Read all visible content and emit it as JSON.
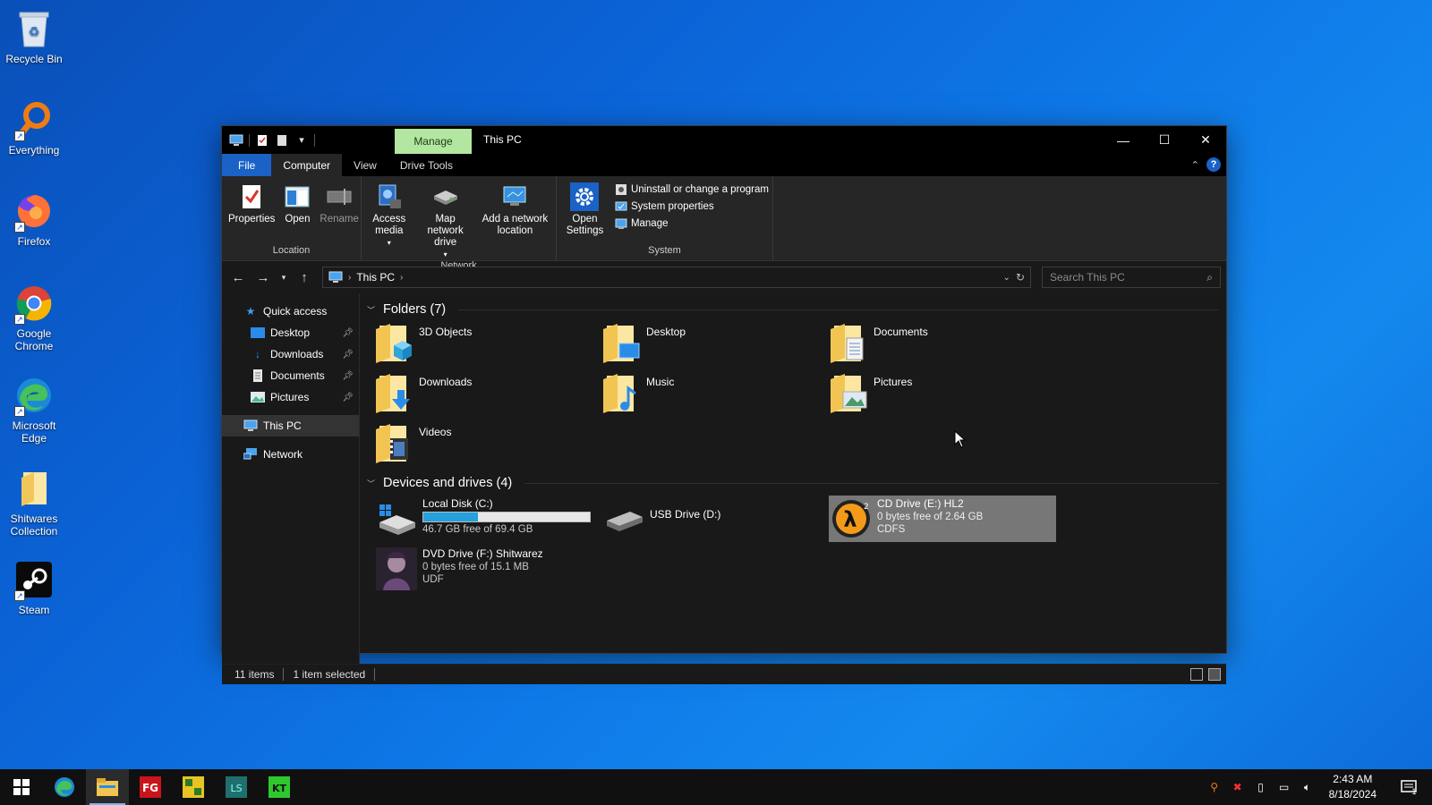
{
  "desktop": {
    "icons": [
      {
        "label": "Recycle Bin",
        "icon": "recycle-bin-icon"
      },
      {
        "label": "Everything",
        "icon": "everything-search-icon"
      },
      {
        "label": "Firefox",
        "icon": "firefox-icon"
      },
      {
        "label": "Google Chrome",
        "icon": "chrome-icon"
      },
      {
        "label": "Microsoft Edge",
        "icon": "edge-icon"
      },
      {
        "label": "Shitwares Collection",
        "icon": "folder-icon"
      },
      {
        "label": "Steam",
        "icon": "steam-icon"
      }
    ]
  },
  "window": {
    "manage_tab": "Manage",
    "title": "This PC",
    "tabs": {
      "file": "File",
      "computer": "Computer",
      "view": "View",
      "drive_tools": "Drive Tools"
    },
    "ribbon": {
      "location": {
        "label": "Location",
        "properties": "Properties",
        "open": "Open",
        "rename": "Rename"
      },
      "network": {
        "label": "Network",
        "access_media": "Access media",
        "map_drive": "Map network drive",
        "add_location": "Add a network location"
      },
      "system": {
        "label": "System",
        "open_settings": "Open Settings",
        "uninstall": "Uninstall or change a program",
        "system_properties": "System properties",
        "manage": "Manage"
      }
    },
    "address": {
      "crumb": "This PC",
      "search_placeholder": "Search This PC"
    },
    "navpane": {
      "quick_access": "Quick access",
      "items": [
        {
          "label": "Desktop"
        },
        {
          "label": "Downloads"
        },
        {
          "label": "Documents"
        },
        {
          "label": "Pictures"
        }
      ],
      "this_pc": "This PC",
      "network": "Network"
    },
    "folders": {
      "header": "Folders (7)",
      "items": [
        {
          "name": "3D Objects"
        },
        {
          "name": "Desktop"
        },
        {
          "name": "Documents"
        },
        {
          "name": "Downloads"
        },
        {
          "name": "Music"
        },
        {
          "name": "Pictures"
        },
        {
          "name": "Videos"
        }
      ]
    },
    "drives": {
      "header": "Devices and drives (4)",
      "items": [
        {
          "name": "Local Disk (C:)",
          "free": "46.7 GB free of 69.4 GB",
          "used_fraction": 0.33
        },
        {
          "name": "USB Drive (D:)"
        },
        {
          "name": "CD Drive (E:) HL2",
          "free": "0 bytes free of 2.64 GB",
          "fs": "CDFS"
        },
        {
          "name": "DVD Drive (F:) Shitwarez",
          "free": "0 bytes free of 15.1 MB",
          "fs": "UDF"
        }
      ]
    },
    "status": {
      "items": "11 items",
      "selected": "1 item selected"
    }
  },
  "taskbar": {
    "time": "2:43 AM",
    "date": "8/18/2024",
    "notification_count": "1",
    "colors": {
      "accent": "#1a62c6",
      "manage_tab": "#b3e6a0",
      "drive_bar": "#26a0da"
    }
  }
}
